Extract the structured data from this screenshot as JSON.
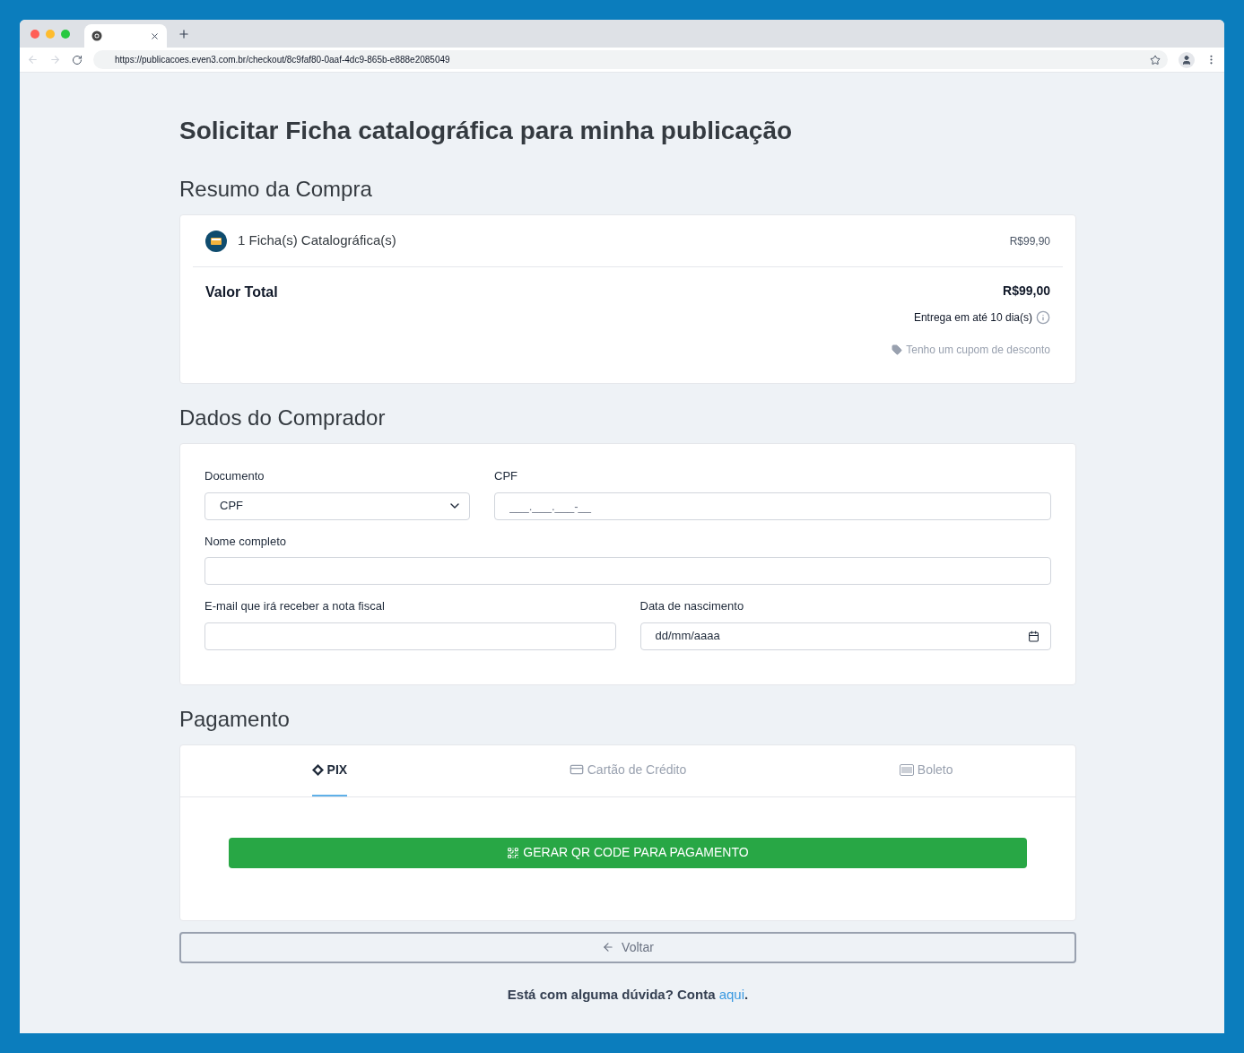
{
  "browser": {
    "url": "https://publicacoes.even3.com.br/checkout/8c9faf80-0aaf-4dc9-865b-e888e2085049"
  },
  "title": "Solicitar Ficha catalográfica para minha publicação",
  "summary": {
    "heading": "Resumo da Compra",
    "item": {
      "name": "1 Ficha(s) Catalográfica(s)",
      "price": "R$99,90"
    },
    "total_label": "Valor Total",
    "total": "R$99,00",
    "delivery": "Entrega em até 10 dia(s)",
    "coupon": "Tenho um cupom de desconto"
  },
  "buyer": {
    "heading": "Dados do Comprador",
    "rows": [
      [
        {
          "kind": "select",
          "label": "Documento",
          "value": "CPF"
        },
        {
          "kind": "text",
          "label": "CPF",
          "placeholder": "___.___.___-__"
        }
      ],
      [
        {
          "kind": "text",
          "label": "Nome completo"
        }
      ],
      [
        {
          "kind": "text",
          "label": "E-mail que irá receber a nota fiscal"
        },
        {
          "kind": "date",
          "label": "Data de nascimento",
          "value": "dd/mm/aaaa"
        }
      ]
    ]
  },
  "payment": {
    "heading": "Pagamento",
    "tabs": [
      {
        "kind": "pix",
        "label": "PIX",
        "selected": true
      },
      {
        "kind": "card",
        "label": "Cartão de Crédito",
        "selected": false
      },
      {
        "kind": "boleto",
        "label": "Boleto",
        "selected": false
      }
    ],
    "button": "GERAR QR CODE PARA PAGAMENTO"
  },
  "back_button": "Voltar",
  "footer": {
    "text": "Está com alguma dúvida? Conta ",
    "link": "aqui",
    "end": "."
  }
}
